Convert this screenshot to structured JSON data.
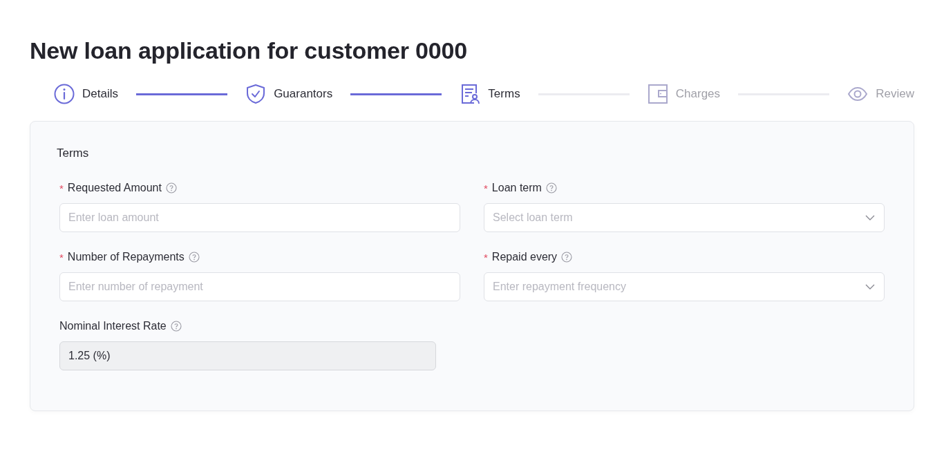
{
  "title": "New loan application for customer 0000",
  "steps": [
    {
      "label": "Details",
      "active": true
    },
    {
      "label": "Guarantors",
      "active": true
    },
    {
      "label": "Terms",
      "active": true
    },
    {
      "label": "Charges",
      "active": false
    },
    {
      "label": "Review",
      "active": false
    }
  ],
  "section": {
    "title": "Terms",
    "fields": [
      {
        "marker": "*",
        "label": "Requested Amount",
        "kind": "input",
        "placeholder": "Enter loan amount"
      },
      {
        "marker": "*",
        "label": "Loan term",
        "kind": "select",
        "placeholder": "Select loan term"
      },
      {
        "marker": "*",
        "label": "Number of Repayments",
        "kind": "input",
        "placeholder": "Enter number of repayment"
      },
      {
        "marker": "*",
        "label": "Repaid every",
        "kind": "select",
        "placeholder": "Enter repayment frequency"
      },
      {
        "label": "Nominal Interest Rate",
        "kind": "input",
        "value": "1.25 (%)",
        "disabled": true
      }
    ]
  }
}
